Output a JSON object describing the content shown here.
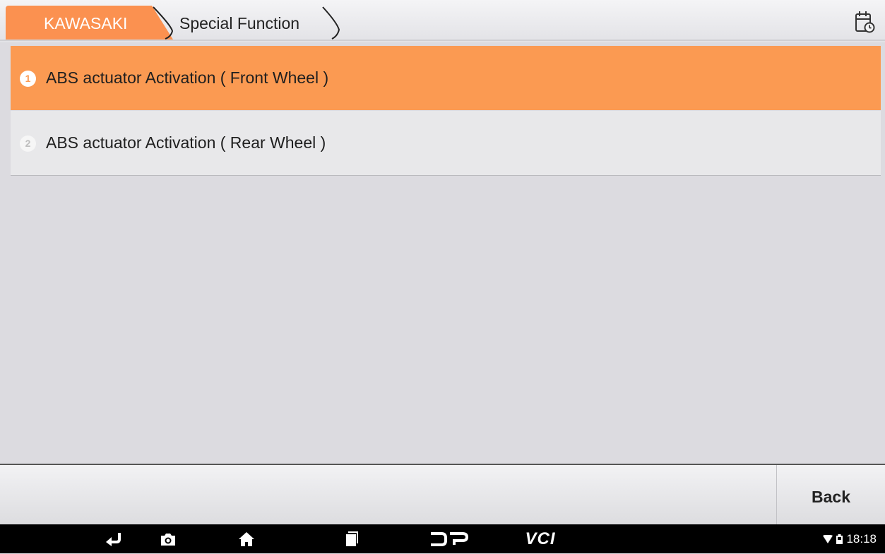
{
  "header": {
    "breadcrumb": [
      "KAWASAKI",
      "Special Function"
    ],
    "report_icon": "calendar-clock-icon"
  },
  "menu": {
    "items": [
      {
        "number": "1",
        "label": "ABS actuator Activation ( Front Wheel )",
        "selected": true
      },
      {
        "number": "2",
        "label": "ABS actuator Activation ( Rear Wheel )",
        "selected": false
      }
    ]
  },
  "toolbar": {
    "back_label": "Back"
  },
  "navbar": {
    "icons": [
      "back-arrow-icon",
      "camera-icon",
      "home-icon",
      "recent-apps-icon",
      "dp-logo-icon",
      "vci-logo-icon"
    ],
    "vci_text": "VCI",
    "dp_text": "DP",
    "time": "18:18"
  },
  "colors": {
    "accent": "#fb9150",
    "selected_row": "#fb9a52",
    "background": "#dcdbe0"
  }
}
